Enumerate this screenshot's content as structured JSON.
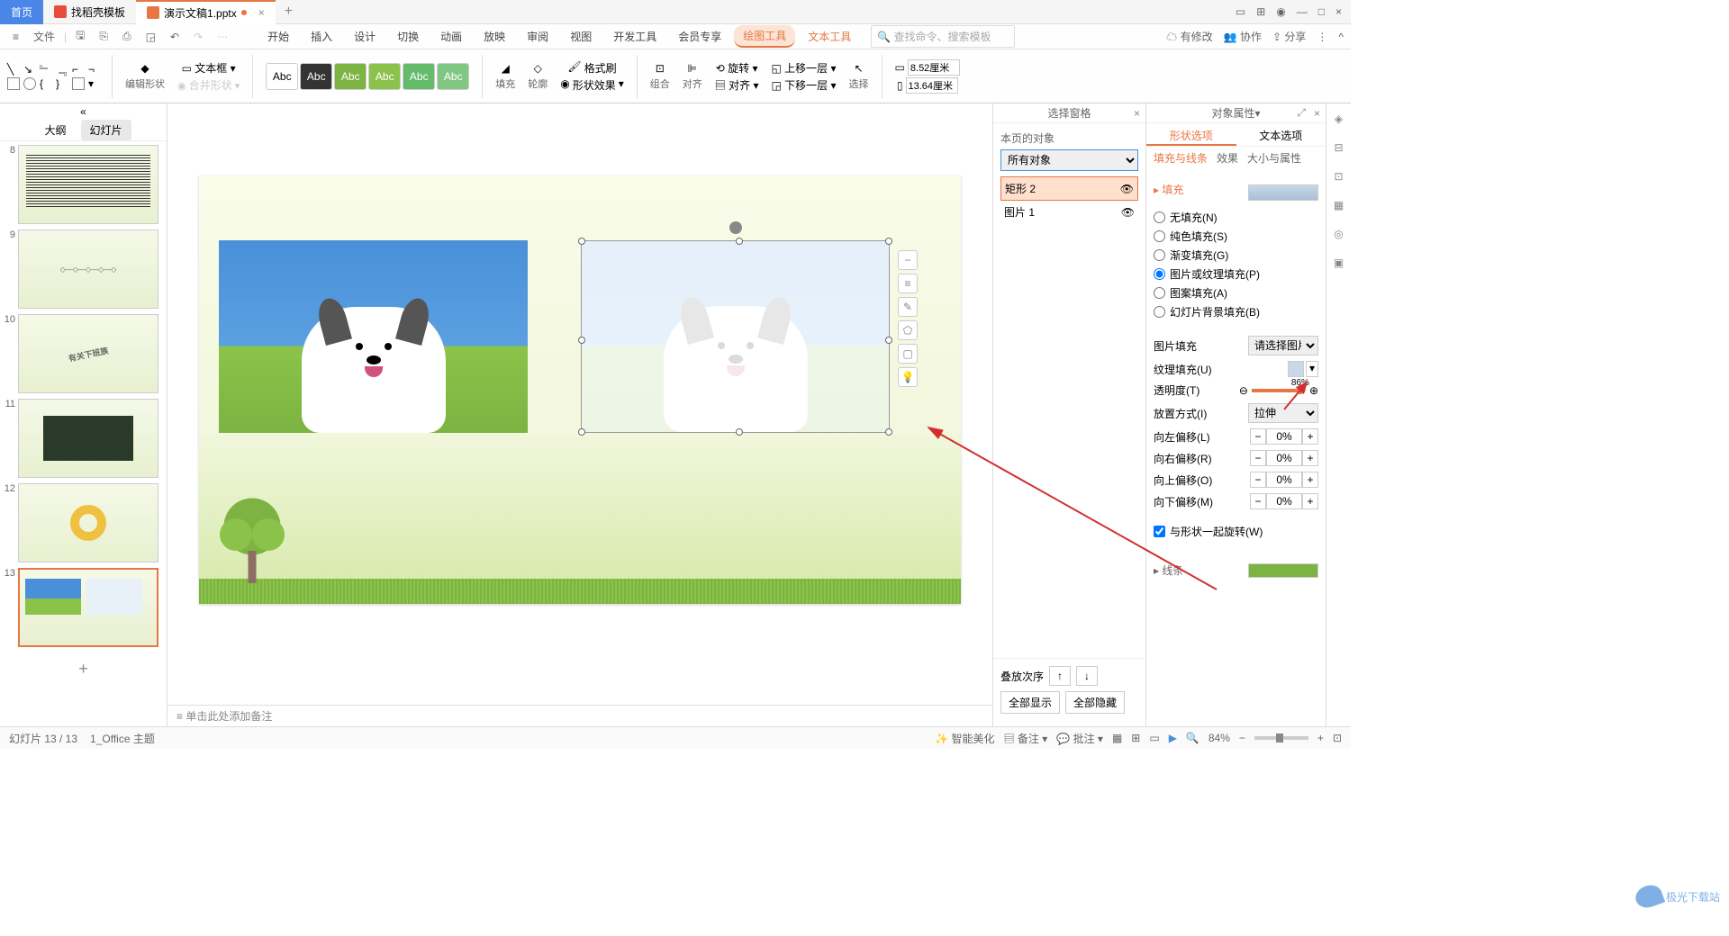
{
  "tabs": {
    "home": "首页",
    "templates": "找稻壳模板",
    "doc": "演示文稿1.pptx"
  },
  "qat": {
    "file": "文件"
  },
  "menu": {
    "start": "开始",
    "insert": "插入",
    "design": "设计",
    "transition": "切换",
    "animation": "动画",
    "slideshow": "放映",
    "review": "审阅",
    "view": "视图",
    "dev": "开发工具",
    "member": "会员专享",
    "drawing": "绘图工具",
    "text": "文本工具"
  },
  "search": {
    "placeholder": "查找命令、搜索模板"
  },
  "top_right": {
    "changes": "有修改",
    "collab": "协作",
    "share": "分享"
  },
  "ribbon": {
    "edit_shape": "编辑形状",
    "text_box": "文本框",
    "merge": "合并形状",
    "abc": "Abc",
    "fill": "填充",
    "outline": "轮廓",
    "effects": "形状效果",
    "format_painter": "格式刷",
    "group": "组合",
    "align": "对齐",
    "rotate": "旋转",
    "bring_forward": "上移一层",
    "send_backward": "下移一层",
    "select": "选择",
    "width": "8.52厘米",
    "height": "13.64厘米"
  },
  "left_tabs": {
    "outline": "大纲",
    "slides": "幻灯片"
  },
  "slide_numbers": [
    "8",
    "9",
    "10",
    "11",
    "12",
    "13"
  ],
  "notes": {
    "placeholder": "单击此处添加备注"
  },
  "selection_pane": {
    "title": "选择窗格",
    "label": "本页的对象",
    "filter": "所有对象",
    "obj1": "矩形 2",
    "obj2": "图片 1",
    "stack": "叠放次序",
    "show_all": "全部显示",
    "hide_all": "全部隐藏"
  },
  "props": {
    "title": "对象属性",
    "tab_shape": "形状选项",
    "tab_text": "文本选项",
    "sub_fill": "填充与线条",
    "sub_effect": "效果",
    "sub_size": "大小与属性",
    "section_fill": "填充",
    "no_fill": "无填充(N)",
    "solid_fill": "纯色填充(S)",
    "gradient_fill": "渐变填充(G)",
    "picture_fill": "图片或纹理填充(P)",
    "pattern_fill": "图案填充(A)",
    "slide_bg_fill": "幻灯片背景填充(B)",
    "pic_fill": "图片填充",
    "pic_select": "请选择图片",
    "texture": "纹理填充(U)",
    "transparency": "透明度(T)",
    "transparency_val": "86%",
    "placement": "放置方式(I)",
    "placement_val": "拉伸",
    "offset_left": "向左偏移(L)",
    "offset_right": "向右偏移(R)",
    "offset_top": "向上偏移(O)",
    "offset_bottom": "向下偏移(M)",
    "offset_val": "0%",
    "rotate_with": "与形状一起旋转(W)",
    "section_line": "线条"
  },
  "status": {
    "slide": "幻灯片 13 / 13",
    "theme": "1_Office 主题",
    "beautify": "智能美化",
    "notes": "备注",
    "comments": "批注",
    "zoom": "84%"
  },
  "watermark": "极光下载站"
}
